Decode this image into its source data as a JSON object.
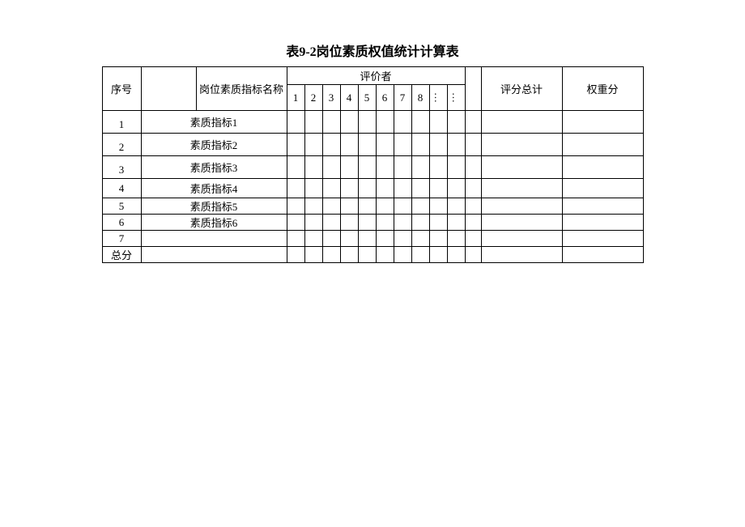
{
  "title": "表9-2岗位素质权值统计计算表",
  "headers": {
    "sequence": "序号",
    "indicator_name": "岗位素质指标名称",
    "evaluator": "评价者",
    "score_total": "评分总计",
    "weight": "权重分",
    "evaluator_cols": [
      "1",
      "2",
      "3",
      "4",
      "5",
      "6",
      "7",
      "8",
      "…",
      "…"
    ]
  },
  "rows": [
    {
      "seq": "1",
      "name": "素质指标1"
    },
    {
      "seq": "2",
      "name": "素质指标2"
    },
    {
      "seq": "3",
      "name": "素质指标3"
    },
    {
      "seq": "4",
      "name": "素质指标4"
    },
    {
      "seq": "5",
      "name": "素质指标5"
    },
    {
      "seq": "6",
      "name": "素质指标6"
    },
    {
      "seq": "7",
      "name": ""
    }
  ],
  "footer": {
    "label": "总分"
  }
}
